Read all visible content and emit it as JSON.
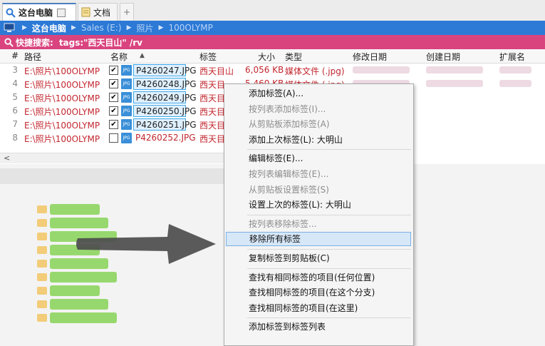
{
  "tabs": [
    {
      "label": "这台电脑",
      "icon": "search-icon",
      "active": true
    },
    {
      "label": "文档",
      "icon": "document-icon",
      "active": false
    }
  ],
  "tab_add_glyph": "+",
  "breadcrumb": {
    "items": [
      "这台电脑",
      "Sales (E:)",
      "照片",
      "100OLYMP"
    ]
  },
  "quick_search": {
    "label": "快捷搜索:",
    "query": "tags:\"西天目山\" /rv"
  },
  "columns": {
    "num": "#",
    "path": "路径",
    "name": "名称",
    "sort_glyph": "▲",
    "tags": "标签",
    "size": "大小",
    "type": "类型",
    "modified": "修改日期",
    "created": "创建日期",
    "ext": "扩展名"
  },
  "rows": [
    {
      "num": "3",
      "path": "E:\\照片\\100OLYMP",
      "checked": true,
      "name": "P4260247.JPG",
      "tag": "西天目山",
      "size": "6,056 KB",
      "type": "媒体文件 (.jpg)",
      "selected": true
    },
    {
      "num": "4",
      "path": "E:\\照片\\100OLYMP",
      "checked": true,
      "name": "P4260248.JPG",
      "tag": "西天目",
      "size": "5,460 KB",
      "type": "媒体文件 (.jpg)",
      "selected": true
    },
    {
      "num": "5",
      "path": "E:\\照片\\100OLYMP",
      "checked": true,
      "name": "P4260249.JPG",
      "tag": "西天目",
      "size": "",
      "type": "",
      "selected": true
    },
    {
      "num": "6",
      "path": "E:\\照片\\100OLYMP",
      "checked": true,
      "name": "P4260250.JPG",
      "tag": "西天目",
      "size": "",
      "type": "",
      "selected": true
    },
    {
      "num": "7",
      "path": "E:\\照片\\100OLYMP",
      "checked": true,
      "name": "P4260251.JPG",
      "tag": "西天目",
      "size": "",
      "type": "",
      "selected": true
    },
    {
      "num": "8",
      "path": "E:\\照片\\100OLYMP",
      "checked": false,
      "name": "P4260252.JPG",
      "tag": "西天目",
      "size": "",
      "type": "",
      "selected": false
    }
  ],
  "file_badge": "JPG",
  "scroll_left_glyph": "<",
  "context_menu": {
    "groups": [
      [
        {
          "label": "添加标签(A)...",
          "disabled": false
        },
        {
          "label": "按列表添加标签(I)...",
          "disabled": true
        },
        {
          "label": "从剪贴板添加标签(A)",
          "disabled": true
        },
        {
          "label": "添加上次标签(L): 大明山",
          "disabled": false
        }
      ],
      [
        {
          "label": "编辑标签(E)...",
          "disabled": false
        },
        {
          "label": "按列表编辑标签(E)...",
          "disabled": true
        },
        {
          "label": "从剪贴板设置标签(S)",
          "disabled": true
        },
        {
          "label": "设置上次的标签(L): 大明山",
          "disabled": false
        }
      ],
      [
        {
          "label": "按列表移除标签...",
          "disabled": true
        },
        {
          "label": "移除所有标签",
          "disabled": false,
          "highlighted": true
        }
      ],
      [
        {
          "label": "复制标签到剪贴板(C)",
          "disabled": false
        }
      ],
      [
        {
          "label": "查找有相同标签的项目(任何位置)",
          "disabled": false
        },
        {
          "label": "查找相同标签的项目(在这个分支)",
          "disabled": false
        },
        {
          "label": "查找相同标签的项目(在这里)",
          "disabled": false
        }
      ],
      [
        {
          "label": "添加标签到标签列表",
          "disabled": false
        }
      ]
    ]
  },
  "colors": {
    "breadcrumb_bg": "#2c79d6",
    "quick_search_bg": "#d9447f",
    "path_text": "#c2262e",
    "selection_border": "#3fa7e8",
    "menu_highlight": "#d6e7f8",
    "arrow": "#4d4d4d"
  }
}
